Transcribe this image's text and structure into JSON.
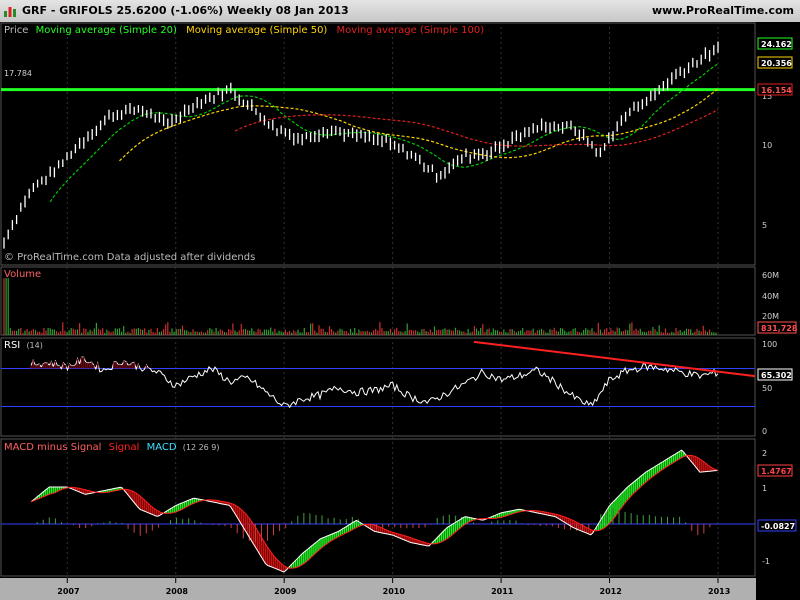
{
  "header": {
    "title": "GRF - GRIFOLS    25.6200 (-1.06%)    Weekly  08 Jan 2013",
    "site": "www.ProRealTime.com"
  },
  "colors": {
    "price": "#ffffff",
    "sma20": "#00cc00",
    "sma50": "#ffd400",
    "sma100": "#e02020",
    "volume": "#ff6060",
    "rsi": "#ffffff",
    "rsi_fill": "#6a0a14",
    "band": "#3040ff",
    "trend": "#ff2020",
    "green": "#22ff22",
    "grid": "#333333"
  },
  "price_panel": {
    "label_price": "Price",
    "label_ma20": "Moving average (Simple 20)",
    "label_ma50": "Moving average (Simple 50)",
    "label_ma100": "Moving average (Simple 100)",
    "watermark": "© ProRealTime.com  Data adjusted after dividends",
    "resistance": 17.784,
    "resistance_label": "17.784",
    "badge_ma20": "24.162",
    "badge_ma50": "20.356",
    "badge_ma100": "16.154",
    "y_ticks": [
      "15",
      "10",
      "5"
    ]
  },
  "volume_panel": {
    "label": "Volume",
    "y_ticks": [
      "60M",
      "40M",
      "20M"
    ],
    "badge": "831,728"
  },
  "rsi_panel": {
    "label": "RSI",
    "params": "(14)",
    "y_ticks": [
      "100",
      "50",
      "0"
    ],
    "upper_band": 70,
    "lower_band": 30,
    "badge": "65.302"
  },
  "macd_panel": {
    "label_hist": "MACD minus Signal",
    "label_signal": "Signal",
    "label_macd": "MACD",
    "params": "(12 26 9)",
    "y_ticks": [
      "2",
      "1",
      "-1"
    ],
    "badge_macd": "1.4767",
    "badge_hist": "-0.0827"
  },
  "chart_data": {
    "type": "line",
    "x_labels": [
      "2007",
      "2008",
      "2009",
      "2010",
      "2011",
      "2012",
      "2013"
    ],
    "price": {
      "x": [
        "2006-06",
        "2006-09",
        "2006-12",
        "2007-03",
        "2007-06",
        "2007-09",
        "2007-12",
        "2008-03",
        "2008-07",
        "2008-10",
        "2008-12",
        "2009-03",
        "2009-06",
        "2009-09",
        "2009-12",
        "2010-03",
        "2010-06",
        "2010-09",
        "2010-12",
        "2011-03",
        "2011-06",
        "2011-09",
        "2011-12",
        "2012-03",
        "2012-06",
        "2012-09",
        "2012-12",
        "2013-01"
      ],
      "close": [
        4.5,
        7.2,
        8.8,
        11.5,
        14.2,
        15.0,
        13.0,
        15.5,
        17.8,
        14.5,
        12.5,
        11.5,
        12.5,
        11.8,
        11.2,
        10.0,
        8.2,
        9.8,
        10.2,
        11.8,
        13.0,
        12.6,
        10.0,
        14.5,
        17.0,
        21.0,
        24.5,
        25.62
      ]
    },
    "sma20": {
      "name": "Moving average (Simple 20)",
      "last": 24.162
    },
    "sma50": {
      "name": "Moving average (Simple 50)",
      "last": 20.356
    },
    "sma100": {
      "name": "Moving average (Simple 100)",
      "last": 16.154
    },
    "volume_last": 831728,
    "rsi": {
      "name": "RSI",
      "last": 65.302,
      "upper": 70,
      "lower": 30
    },
    "macd": {
      "macd_last": 1.4767,
      "hist_last": -0.0827
    },
    "resistance": 17.784
  }
}
